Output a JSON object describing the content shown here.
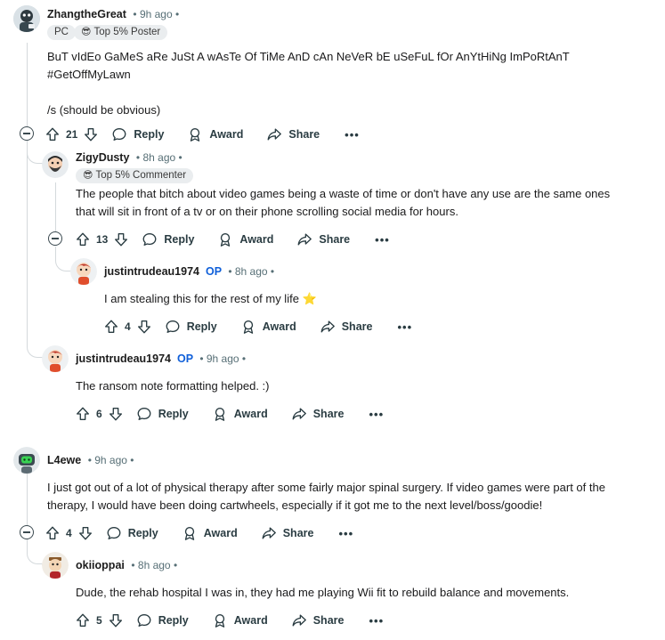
{
  "comments": [
    {
      "username": "ZhangtheGreat",
      "op": "",
      "time": "9h ago",
      "flairs": [
        {
          "emoji": "",
          "text": "PC"
        },
        {
          "emoji": "😎",
          "text": "Top 5% Poster"
        }
      ],
      "lines": [
        "BuT vIdEo GaMeS aRe JuSt A wAsTe Of TiMe AnD cAn NeVeR bE uSeFuL fOr AnYtHiNg ImPoRtAnT",
        "#GetOffMyLawn",
        "",
        "/s (should be obvious)"
      ],
      "votes": "21"
    },
    {
      "username": "ZigyDusty",
      "op": "",
      "time": "8h ago",
      "flairs": [
        {
          "emoji": "😎",
          "text": "Top 5% Commenter"
        }
      ],
      "lines": [
        "The people that bitch about video games being a waste of time or don't have any use are the same ones",
        "that will sit in front of a tv or on their phone scrolling social media for hours."
      ],
      "votes": "13"
    },
    {
      "username": "justintrudeau1974",
      "op": "OP",
      "time": "8h ago",
      "flairs": [],
      "lines": [
        "I am stealing this for the rest of my life ⭐"
      ],
      "votes": "4"
    },
    {
      "username": "justintrudeau1974",
      "op": "OP",
      "time": "9h ago",
      "flairs": [],
      "lines": [
        "The ransom note formatting helped. :)"
      ],
      "votes": "6"
    },
    {
      "username": "L4ewe",
      "op": "",
      "time": "9h ago",
      "flairs": [],
      "lines": [
        "I just got out of a lot of physical therapy after some fairly major spinal surgery. If video games were part of the",
        "therapy, I would have been doing cartwheels, especially if it got me to the next level/boss/goodie!"
      ],
      "votes": "4"
    },
    {
      "username": "okiioppai",
      "op": "",
      "time": "8h ago",
      "flairs": [],
      "lines": [
        "Dude, the rehab hospital I was in, they had me playing Wii fit to rebuild balance and movements."
      ],
      "votes": "5"
    }
  ],
  "actions": {
    "reply": "Reply",
    "award": "Award",
    "share": "Share",
    "more": "•••"
  },
  "separator": "•",
  "icons": [
    "upvote-icon",
    "downvote-icon",
    "reply-icon",
    "award-icon",
    "share-icon",
    "more-icon",
    "collapse-icon"
  ],
  "colors": {
    "op": "#0f5fd9",
    "meta": "#576f76",
    "thread_line": "#d4d9dc",
    "flair_bg": "#eaedef"
  }
}
